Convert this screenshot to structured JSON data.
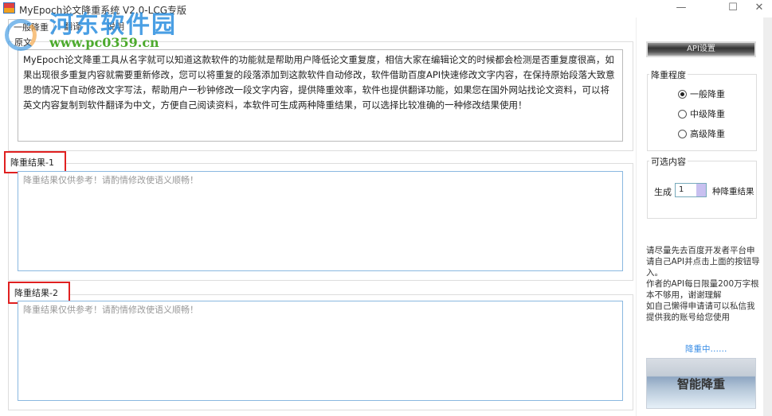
{
  "window": {
    "title": "MyEpoch论文降重系统 V2.0-LCG专版",
    "minimize": "—",
    "maximize": "☐",
    "close": "✕"
  },
  "watermark": {
    "cn": "河东软件园",
    "url": "www.pc0359.cn"
  },
  "tabs": [
    {
      "label": "一般降重"
    },
    {
      "label": "翻译"
    },
    {
      "label": "说明"
    }
  ],
  "original": {
    "label": "原文",
    "text": "MyEpoch论文降重工具从名字就可以知道这款软件的功能就是帮助用户降低论文重复度，相信大家在编辑论文的时候都会检测是否重复度很高，如果出现很多重复内容就需要重新修改，您可以将重复的段落添加到这款软件自动修改，软件借助百度API快速修改文字内容，在保持原始段落大致意思的情况下自动修改文字写法，帮助用户一秒钟修改一段文字内容，提供降重效率，软件也提供翻译功能，如果您在国外网站找论文资料，可以将英文内容复制到软件翻译为中文，方便自己阅读资料，本软件可生成两种降重结果，可以选择比较准确的一种修改结果使用！"
  },
  "result1": {
    "label": "降重结果-1",
    "placeholder": "降重结果仅供参考！请酌情修改使语义顺畅！"
  },
  "result2": {
    "label": "降重结果-2",
    "placeholder": "降重结果仅供参考！请酌情修改使语义顺畅！"
  },
  "sidebar": {
    "api_button": "API设置",
    "level": {
      "label": "降重程度",
      "options": [
        {
          "label": "一般降重",
          "selected": true
        },
        {
          "label": "中级降重",
          "selected": false
        },
        {
          "label": "高级降重",
          "selected": false
        }
      ]
    },
    "optional": {
      "label": "可选内容",
      "prefix": "生成",
      "count": "1",
      "suffix": "种降重结果"
    },
    "info": [
      "请尽量先去百度开发者平台申请自己API并点击上面的按钮导入。",
      "作者的API每日限量200万字根本不够用，谢谢理解",
      "如自己懒得申请请可以私信我提供我的账号给您使用"
    ],
    "status": "降重中……",
    "run_button": "智能降重"
  }
}
